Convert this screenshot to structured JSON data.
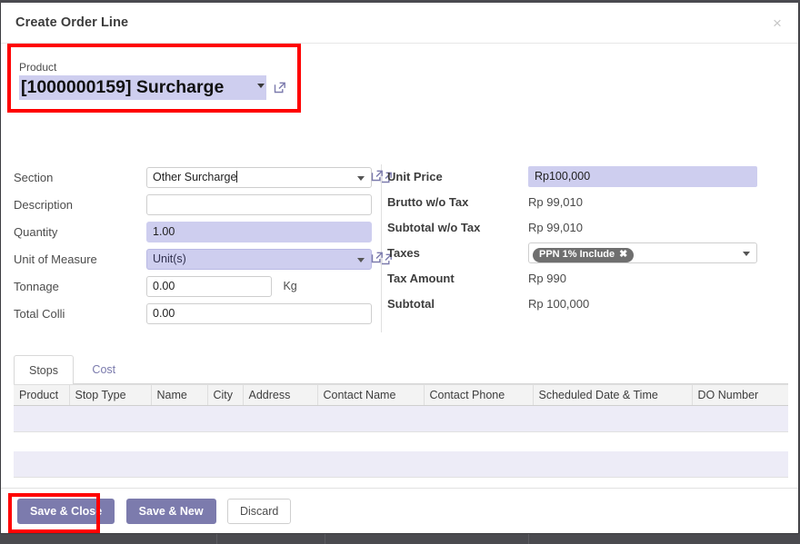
{
  "window": {
    "title": "Create Order Line",
    "close_label": "×"
  },
  "product": {
    "label": "Product",
    "value": "[1000000159] Surcharge",
    "external_link_icon": "external-link-icon"
  },
  "left_form": {
    "rows": [
      {
        "label": "Section",
        "value": "Other Surcharge",
        "type": "select",
        "highlight": false,
        "external_link": true,
        "suffix": ""
      },
      {
        "label": "Description",
        "value": "",
        "type": "text",
        "highlight": false,
        "external_link": false,
        "suffix": ""
      },
      {
        "label": "Quantity",
        "value": "1.00",
        "type": "text",
        "highlight": true,
        "external_link": false,
        "suffix": ""
      },
      {
        "label": "Unit of Measure",
        "value": "Unit(s)",
        "type": "select",
        "highlight": true,
        "external_link": true,
        "suffix": ""
      },
      {
        "label": "Tonnage",
        "value": "0.00",
        "type": "text",
        "highlight": false,
        "external_link": false,
        "suffix": "Kg"
      },
      {
        "label": "Total Colli",
        "value": "0.00",
        "type": "text",
        "highlight": false,
        "external_link": false,
        "suffix": ""
      }
    ]
  },
  "right_form": {
    "rows": [
      {
        "label": "Unit Price",
        "value": "Rp100,000",
        "type": "input-highlight",
        "external_link": true
      },
      {
        "label": "Brutto w/o Tax",
        "value": "Rp 99,010",
        "type": "static",
        "external_link": false
      },
      {
        "label": "Subtotal w/o Tax",
        "value": "Rp 99,010",
        "type": "static",
        "external_link": false
      },
      {
        "label": "Taxes",
        "value": "",
        "type": "tags",
        "external_link": true
      },
      {
        "label": "Tax Amount",
        "value": "Rp 990",
        "type": "static",
        "external_link": false
      },
      {
        "label": "Subtotal",
        "value": "Rp 100,000",
        "type": "static",
        "external_link": false
      }
    ],
    "tax_tag": {
      "text": "PPN 1% Include",
      "remove_label": "✖"
    }
  },
  "tabs": [
    {
      "label": "Stops",
      "active": true
    },
    {
      "label": "Cost",
      "active": false
    }
  ],
  "table": {
    "columns": [
      "Product",
      "Stop Type",
      "Name",
      "City",
      "Address",
      "Contact Name",
      "Contact Phone",
      "Scheduled Date & Time",
      "DO Number"
    ]
  },
  "footer": {
    "save_close": "Save & Close",
    "save_new": "Save & New",
    "discard": "Discard"
  },
  "colors": {
    "primary": "#7c7bad",
    "field_highlight": "#ceceef",
    "annotation": "#ff0000",
    "row_band": "#edecf7",
    "tag": "#6f6f6f"
  }
}
